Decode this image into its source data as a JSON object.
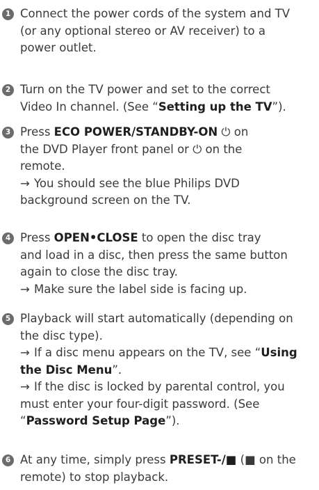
{
  "steps": [
    {
      "num": "1",
      "lines": [
        "Connect the power cords of the system and TV",
        "(or any optional stereo or AV receiver) to a",
        "power outlet."
      ]
    },
    {
      "num": "2",
      "line1": "Turn on the TV power and set to the correct",
      "line2_pre": "Video In channel. (See “",
      "line2_bold": "Setting up the TV",
      "line2_post": "”)."
    },
    {
      "num": "3",
      "press": "Press ",
      "bold": "ECO POWER/STANDBY-ON",
      "power_symbol": "⏻",
      "on": " on",
      "line2_pre": "the DVD Player front panel or ",
      "line2_post": " on the",
      "line3": "remote.",
      "arrow": "→",
      "line4": "You should see the blue Philips DVD",
      "line5": "background screen on the TV."
    },
    {
      "num": "4",
      "press": "Press ",
      "bold": "OPEN•CLOSE",
      "line1_post": " to open the disc tray",
      "line2": "and load in a disc, then press the same button",
      "line3": "again to close the disc tray.",
      "arrow": "→",
      "line4": "Make sure the label side is facing up."
    },
    {
      "num": "5",
      "line1": "Playback will start automatically (depending on",
      "line2": "the disc type).",
      "arrow": "→",
      "line3_pre": "If a disc menu appears on the TV, see “",
      "line3_bold": "Using",
      "line4_bold": "the Disc Menu",
      "line4_post": "”.",
      "line5": "If the disc is locked by parental control, you",
      "line6": "must enter your four-digit password. (See",
      "line7_pre": "“",
      "line7_bold": "Password Setup Page",
      "line7_post": "”)."
    },
    {
      "num": "6",
      "line1_pre": "At any time, simply press ",
      "line1_bold": "PRESET-/■",
      "line1_post": " (■ on the",
      "line2": "remote) to stop playback."
    }
  ]
}
